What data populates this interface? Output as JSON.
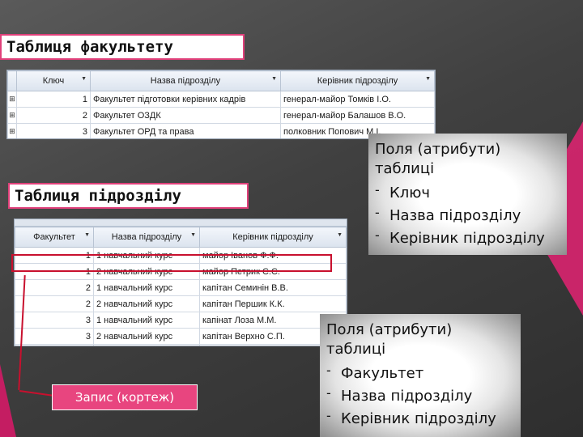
{
  "titles": {
    "faculty": "Таблиця факультету",
    "department": "Таблиця підрозділу"
  },
  "faculty_table": {
    "columns": [
      "Ключ",
      "Назва підрозділу",
      "Керівник підрозділу"
    ],
    "rows": [
      {
        "key": "1",
        "name": "Факультет підготовки керівних кадрів",
        "head": "генерал-майор Томків І.О."
      },
      {
        "key": "2",
        "name": "Факультет ОЗДК",
        "head": "генерал-майор Балашов В.О."
      },
      {
        "key": "3",
        "name": "Факультет ОРД та права",
        "head": "полковник Попович М.І."
      }
    ]
  },
  "department_table": {
    "columns": [
      "Факультет",
      "Назва підрозділу",
      "Керівник підрозділу"
    ],
    "rows": [
      {
        "faculty": "1",
        "name": "1 навчальний курс",
        "head": "майор Іванов Ф.Ф."
      },
      {
        "faculty": "1",
        "name": "2 навчальний курс",
        "head": "майор Петрик С.С."
      },
      {
        "faculty": "2",
        "name": "1 навчальний курс",
        "head": "капітан Семинін В.В."
      },
      {
        "faculty": "2",
        "name": "2 навчальний курс",
        "head": "капітан Першик К.К."
      },
      {
        "faculty": "3",
        "name": "1 навчальний курс",
        "head": "капінат Лоза М.М."
      },
      {
        "faculty": "3",
        "name": "2 навчальний курс",
        "head": "капітан Верхно С.П."
      }
    ]
  },
  "callout_faculty": {
    "title_line1": "Поля (атрибути)",
    "title_line2": "таблиці",
    "items": [
      "Ключ",
      "Назва підрозділу",
      "Керівник підрозділу"
    ]
  },
  "callout_department": {
    "title_line1": "Поля (атрибути)",
    "title_line2": "таблиці",
    "items": [
      "Факультет",
      "Назва підрозділу",
      "Керівник підрозділу"
    ]
  },
  "record_label": "Запис (кортеж)",
  "colors": {
    "accent_pink": "#e8457f",
    "highlight_red": "#c8102e"
  }
}
